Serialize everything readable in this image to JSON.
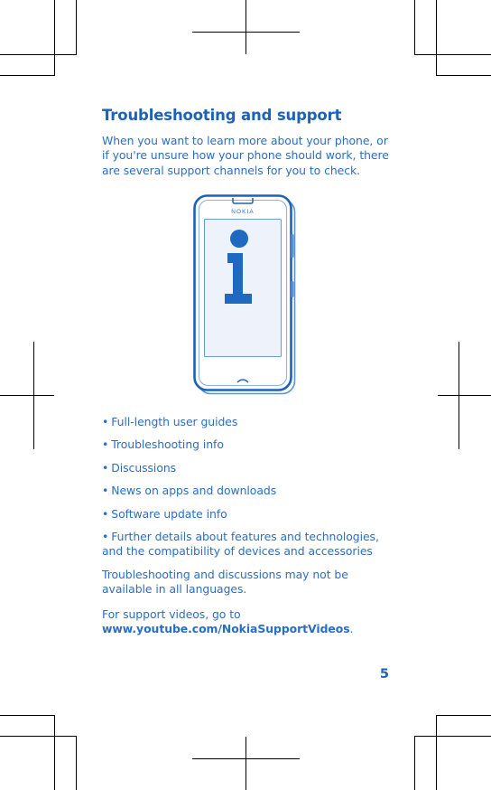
{
  "document": {
    "heading": "Troubleshooting and support",
    "intro": "When you want to learn more about your phone, or if you're unsure how your phone should work, there are several support channels for you to check.",
    "bullets": [
      "Full-length user guides",
      "Troubleshooting info",
      "Discussions",
      "News on apps and downloads",
      "Software update info",
      "Further details about features and technologies, and the compatibility of devices and accessories"
    ],
    "bullet_marker": "•",
    "note": "Troubleshooting and discussions may not be available in all languages.",
    "video_line_prefix": "For support videos, go to ",
    "video_link": "www.youtube.com/NokiaSupportVideos",
    "video_line_suffix": ".",
    "page_number": "5"
  },
  "illustration": {
    "name": "nokia-phone-info-screen",
    "brand_label": "NOKIA",
    "screen_glyph": "i",
    "colors": {
      "outline": "#1c62b9",
      "outline_light": "#5f92d4",
      "screen_fill": "#eef2fb",
      "glyph": "#1f6ac0",
      "body_fill": "#ffffff"
    }
  },
  "print_marks": {
    "label": "crop-and-registration-marks",
    "color": "#000000",
    "corners": [
      "top-left",
      "top-right",
      "bottom-left",
      "bottom-right"
    ],
    "registration_crosses": [
      "top-center",
      "bottom-center",
      "left-middle",
      "right-middle"
    ]
  },
  "theme": {
    "heading_color": "#1c62b9",
    "text_color": "#2a6ec4",
    "background": "#ffffff"
  }
}
